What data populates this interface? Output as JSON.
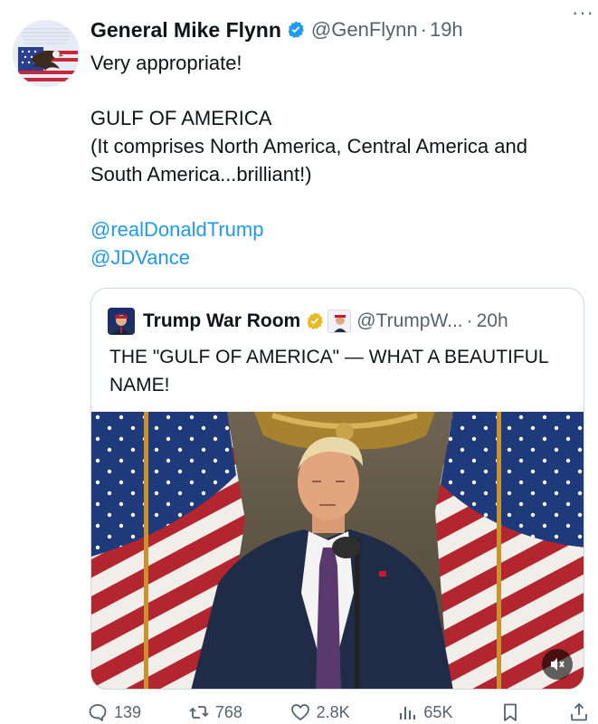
{
  "tweet": {
    "author": {
      "display_name": "General Mike Flynn",
      "handle": "@GenFlynn",
      "separator": "·",
      "time": "19h",
      "more_icon": "more-icon"
    },
    "text": {
      "line1": "Very appropriate!",
      "line2": "GULF OF AMERICA",
      "line3": "(It comprises North America, Central America and South America...brilliant!)",
      "mention1": "@realDonaldTrump",
      "mention2": "@JDVance"
    },
    "quote": {
      "display_name": "Trump War Room",
      "handle": "@TrumpW...",
      "separator": "·",
      "time": "20h",
      "text": "THE \"GULF OF AMERICA\" — WHAT A BEAUTIFUL NAME!",
      "media_icon": "mute-icon"
    },
    "actions": {
      "replies": "139",
      "reposts": "768",
      "likes": "2.8K",
      "views": "65K"
    },
    "colors": {
      "verified": "#1d9bf0",
      "verified_gold": "#e8b923",
      "link": "#1d9bf0",
      "muted": "#536471"
    }
  }
}
